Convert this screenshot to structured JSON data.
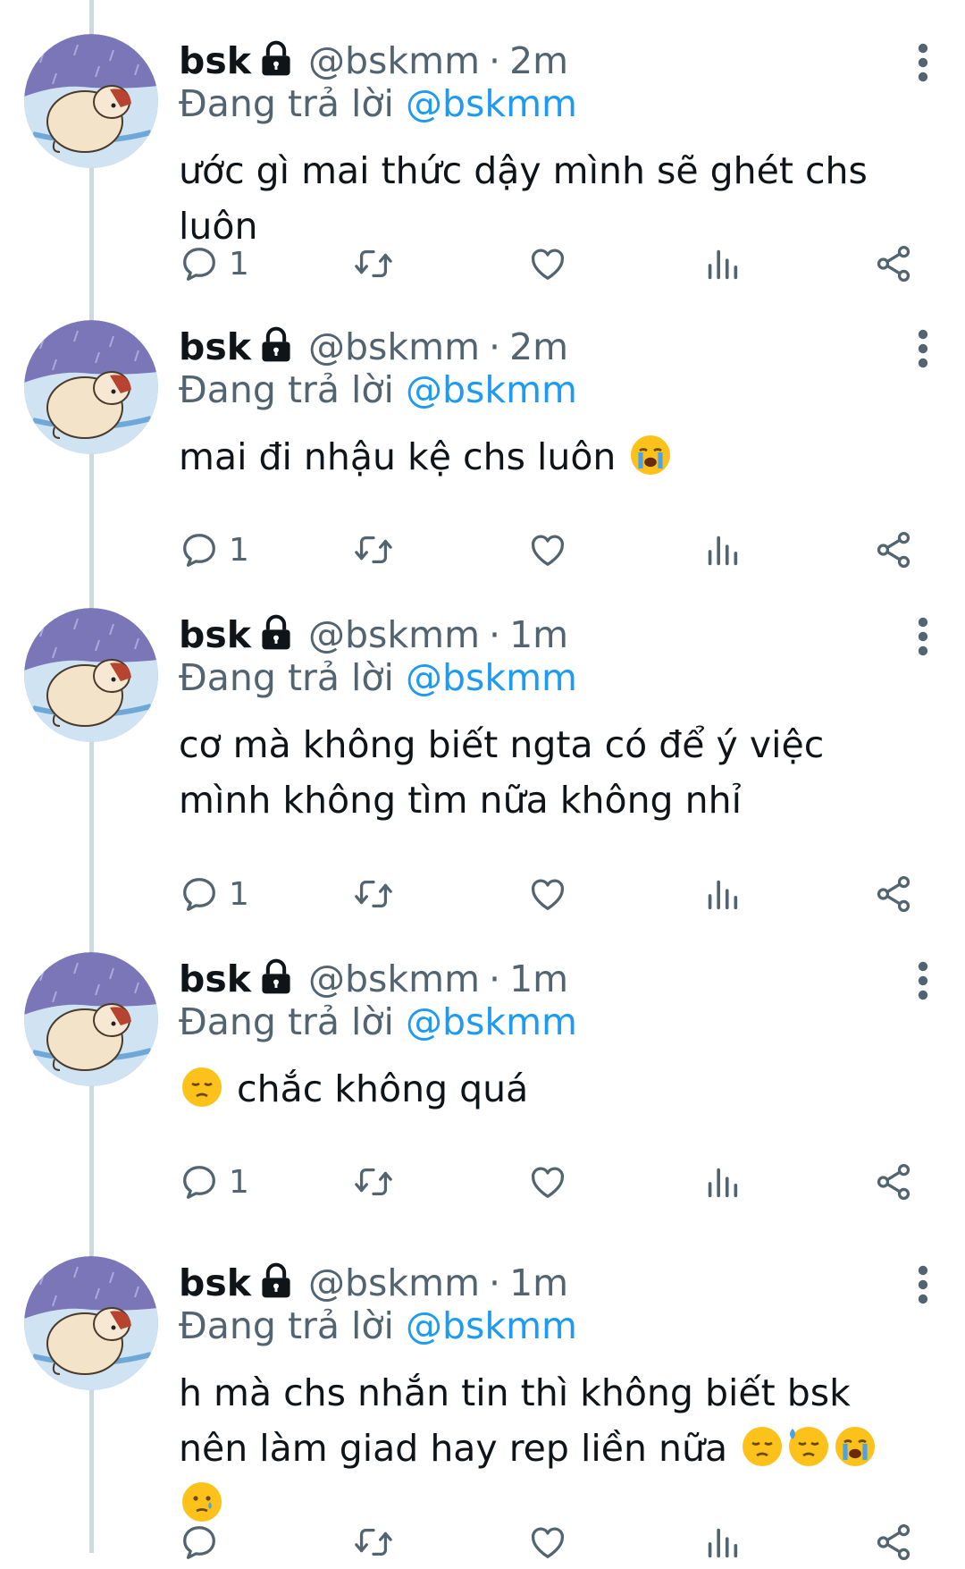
{
  "tweets": [
    {
      "name": "bsk",
      "handle": "@bskmm",
      "time": "2m",
      "replying_prefix": "Đang trả lời",
      "replying_to": "@bskmm",
      "text": "ước gì mai thức dậy mình sẽ ghét chs luôn",
      "reply_count": "1"
    },
    {
      "name": "bsk",
      "handle": "@bskmm",
      "time": "2m",
      "replying_prefix": "Đang trả lời",
      "replying_to": "@bskmm",
      "text": "mai đi nhậu kệ chs luôn",
      "reply_count": "1"
    },
    {
      "name": "bsk",
      "handle": "@bskmm",
      "time": "1m",
      "replying_prefix": "Đang trả lời",
      "replying_to": "@bskmm",
      "text": "cơ mà không biết ngta có để ý việc mình không tìm nữa không nhỉ",
      "reply_count": "1"
    },
    {
      "name": "bsk",
      "handle": "@bskmm",
      "time": "1m",
      "replying_prefix": "Đang trả lời",
      "replying_to": "@bskmm",
      "text": "chắc không quá",
      "reply_count": "1"
    },
    {
      "name": "bsk",
      "handle": "@bskmm",
      "time": "1m",
      "replying_prefix": "Đang trả lời",
      "replying_to": "@bskmm",
      "text": "h mà chs nhắn tin thì không biết bsk nên làm giad hay rep liền nữa",
      "reply_count": ""
    }
  ],
  "icons": {
    "lock": "lock-icon",
    "reply": "reply-icon",
    "retweet": "retweet-icon",
    "like": "heart-icon",
    "views": "views-icon",
    "share": "share-icon",
    "more": "more-icon"
  },
  "colors": {
    "mention": "#1d9bf0",
    "secondary": "#536471",
    "thread_line": "#cfd9de",
    "avatar_bg": "#7a76b8"
  }
}
